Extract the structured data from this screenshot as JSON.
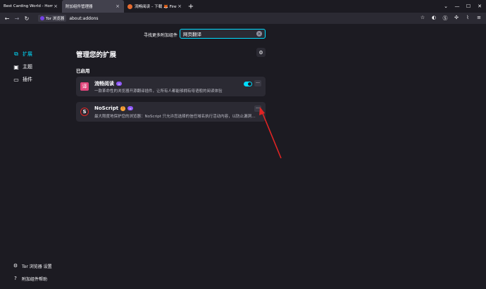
{
  "tabs": [
    {
      "label": "Best Carding World - Home",
      "active": false
    },
    {
      "label": "附加组件管理器",
      "active": true
    },
    {
      "label": "流畅阅读 – 下载 🦊 Firefox 扩展",
      "active": false
    }
  ],
  "navbar": {
    "identity_label": "Tor 浏览器",
    "url": "about:addons"
  },
  "search": {
    "label": "寻找更多附加组件",
    "value": "网页翻译"
  },
  "sidebar": {
    "items": [
      {
        "label": "扩展",
        "icon": "puzzle-icon",
        "active": true
      },
      {
        "label": "主题",
        "icon": "brush-icon",
        "active": false
      },
      {
        "label": "插件",
        "icon": "plugin-icon",
        "active": false
      }
    ],
    "footer": [
      {
        "label": "Tor 浏览器 设置",
        "icon": "gear-icon"
      },
      {
        "label": "附加组件帮助",
        "icon": "help-icon"
      }
    ]
  },
  "main": {
    "title": "管理您的扩展",
    "section_title": "已启用",
    "extensions": [
      {
        "name": "流畅阅读",
        "icon_text": "译",
        "icon_color": "#e0457b",
        "description": "一款革命性的浏览器开源翻译插件，让所有人都能够拥有母语般的阅读体验",
        "enabled": true
      },
      {
        "name": "NoScript",
        "icon_text": "S",
        "icon_color": "#2b2a33",
        "description": "最大限度地保护您的浏览器：NoScript 只允许您选择的信任域名执行活动内容，以防止漏洞利用。",
        "enabled": true
      }
    ]
  },
  "colors": {
    "accent": "#00ddff",
    "background": "#1c1b22",
    "card": "#2b2a33",
    "annotation_arrow": "#e02424"
  }
}
